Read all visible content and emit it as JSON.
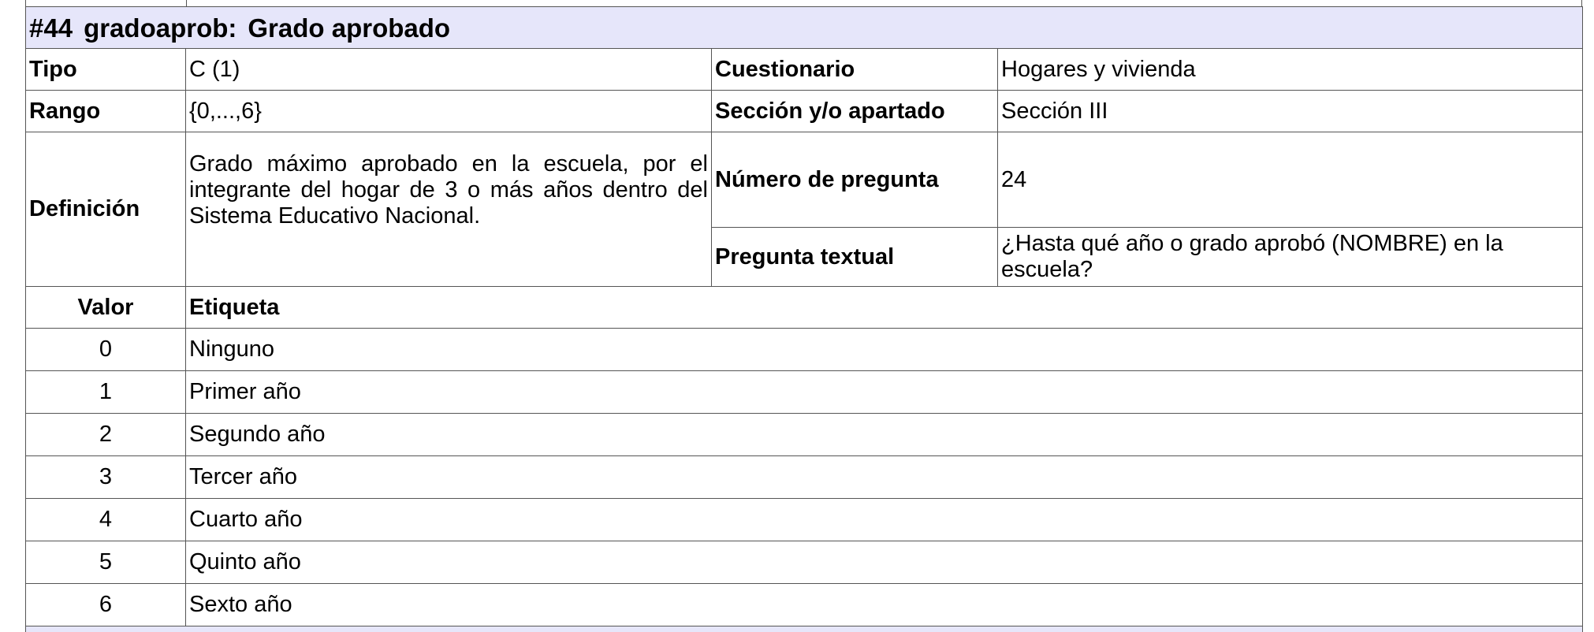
{
  "variable": {
    "number": "#44",
    "name": "gradoaprob:",
    "label": "Grado aprobado"
  },
  "fields": {
    "tipo_label": "Tipo",
    "tipo_value": "C (1)",
    "cuestionario_label": "Cuestionario",
    "cuestionario_value": "Hogares y vivienda",
    "rango_label": "Rango",
    "rango_value": "{0,...,6}",
    "seccion_label": "Sección y/o apartado",
    "seccion_value": "Sección III",
    "definicion_label": "Definición",
    "definicion_value": "Grado máximo aprobado en la escuela, por el integrante del hogar de 3 o más años dentro del Sistema Educativo Nacional.",
    "numero_label": "Número de pregunta",
    "numero_value": "24",
    "pregunta_label": "Pregunta textual",
    "pregunta_value": "¿Hasta qué año o grado aprobó (NOMBRE) en la escuela?"
  },
  "values_header": {
    "valor": "Valor",
    "etiqueta": "Etiqueta"
  },
  "values": [
    {
      "valor": "0",
      "etiqueta": "Ninguno"
    },
    {
      "valor": "1",
      "etiqueta": "Primer año"
    },
    {
      "valor": "2",
      "etiqueta": "Segundo año"
    },
    {
      "valor": "3",
      "etiqueta": "Tercer año"
    },
    {
      "valor": "4",
      "etiqueta": "Cuarto año"
    },
    {
      "valor": "5",
      "etiqueta": "Quinto año"
    },
    {
      "valor": "6",
      "etiqueta": "Sexto año"
    }
  ],
  "colors": {
    "header_background": "#e6e6fa",
    "border": "#555555"
  }
}
